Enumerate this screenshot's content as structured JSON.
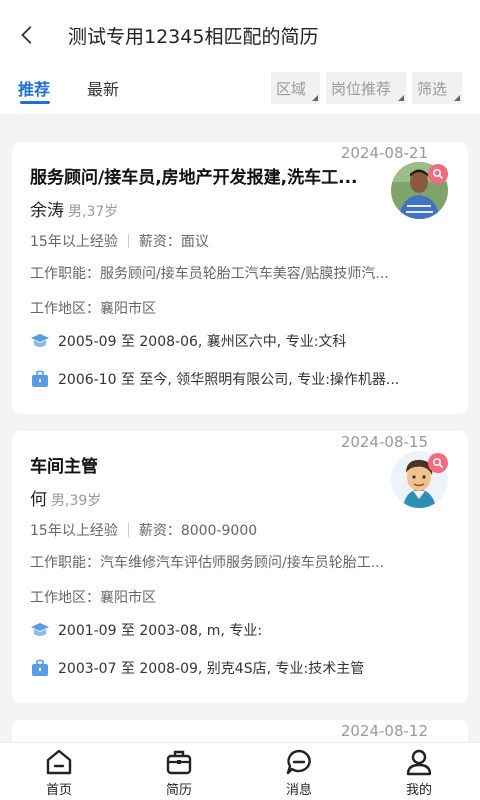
{
  "header": {
    "title": "测试专用12345相匹配的简历"
  },
  "tabs": [
    {
      "label": "推荐",
      "active": true
    },
    {
      "label": "最新",
      "active": false
    }
  ],
  "filters": [
    "区域",
    "岗位推荐",
    "筛选"
  ],
  "resumes": [
    {
      "date": "2024-08-21",
      "job": "服务顾问/接车员,房地产开发报建,洗车工...",
      "name": "余涛",
      "gender_age": "男,37岁",
      "experience": "15年以上经验",
      "salary": "薪资：面议",
      "functions": "工作职能：服务顾问/接车员轮胎工汽车美容/贴膜技师汽...",
      "area": "工作地区：襄阳市区",
      "education": "2005-09 至 2008-06, 襄州区六中, 专业:文科",
      "work": "2006-10 至 至今, 领华照明有限公司, 专业:操作机器..."
    },
    {
      "date": "2024-08-15",
      "job": "车间主管",
      "name": "何",
      "gender_age": "男,39岁",
      "experience": "15年以上经验",
      "salary": "薪资：8000-9000",
      "functions": "工作职能：汽车维修汽车评估师服务顾问/接车员轮胎工...",
      "area": "工作地区：襄阳市区",
      "education": "2001-09 至 2003-08, m, 专业:",
      "work": "2003-07 至 2008-09, 别克4S店, 专业:技术主管"
    },
    {
      "date": "2024-08-12"
    }
  ],
  "bottom_nav": [
    {
      "label": "首页",
      "icon": "home-icon"
    },
    {
      "label": "简历",
      "icon": "resume-icon"
    },
    {
      "label": "消息",
      "icon": "message-icon"
    },
    {
      "label": "我的",
      "icon": "profile-icon"
    }
  ],
  "colors": {
    "accent": "#1f6fd6",
    "edu_icon": "#5b9be6",
    "badge": "#f46b7e"
  }
}
